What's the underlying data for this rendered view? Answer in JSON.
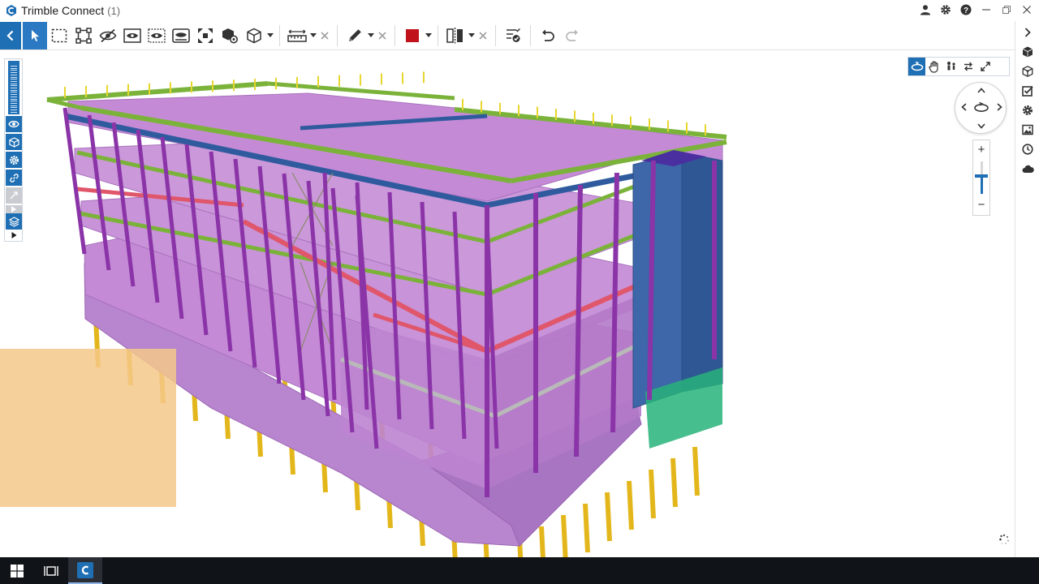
{
  "window": {
    "title": "Trimble Connect",
    "count": "(1)"
  },
  "colors": {
    "accent": "#1f6fb5",
    "column": "#8a34a8",
    "slab": "#c58ad6",
    "foundation": "#b885cf",
    "beam_green": "#7bb33a",
    "beam_blue": "#2f5b9e",
    "beam_red": "#e0566a",
    "railing_yellow": "#e6d62f",
    "pile": "#e3b71c",
    "core": "#3d67a8",
    "section_box": "#f5c88a",
    "paint_swatch": "#c0121b"
  },
  "toolbar": {
    "tools": [
      {
        "name": "back-button",
        "icon": "chevron-left-icon"
      },
      {
        "name": "select-tool",
        "icon": "cursor-icon"
      },
      {
        "name": "box-select-tool",
        "icon": "dashed-rectangle-icon"
      },
      {
        "name": "fit-selection-tool",
        "icon": "fit-frame-icon"
      },
      {
        "name": "hide-tool",
        "icon": "eye-off-icon"
      },
      {
        "name": "isolate-tool",
        "icon": "eye-frame-icon"
      },
      {
        "name": "show-all-tool",
        "icon": "eye-dotted-frame-icon"
      },
      {
        "name": "ghost-tool",
        "icon": "eye-square-icon"
      },
      {
        "name": "fit-all-tool",
        "icon": "expand-arrows-icon"
      },
      {
        "name": "object-settings-tool",
        "icon": "cube-gear-icon"
      },
      {
        "name": "view-cube-tool",
        "icon": "cube-outline-icon"
      },
      {
        "name": "measure-tool",
        "icon": "ruler-icon"
      },
      {
        "name": "markup-tool",
        "icon": "pencil-icon"
      },
      {
        "name": "paint-tool",
        "icon": "color-swatch-icon"
      },
      {
        "name": "section-tool",
        "icon": "section-plane-icon"
      },
      {
        "name": "clash-tool",
        "icon": "checklist-icon"
      },
      {
        "name": "undo-button",
        "icon": "undo-icon"
      },
      {
        "name": "redo-button",
        "icon": "redo-icon"
      }
    ]
  },
  "right_rail": {
    "items": [
      "collapse-right-icon",
      "model-tree-icon",
      "objects-icon",
      "todo-icon",
      "settings-icon",
      "views-icon",
      "history-icon",
      "cloud-icon"
    ]
  },
  "navigation": {
    "modes": [
      "orbit-icon",
      "pan-icon",
      "walk-icon",
      "swap-icon",
      "fullscreen-icon"
    ],
    "active_mode": "orbit-icon"
  },
  "zoom": {
    "plus": "+",
    "minus": "−",
    "level": 0.55
  },
  "taskbar": {
    "items": [
      "windows-start-icon",
      "task-view-icon",
      "trimble-connect-app-icon"
    ]
  }
}
